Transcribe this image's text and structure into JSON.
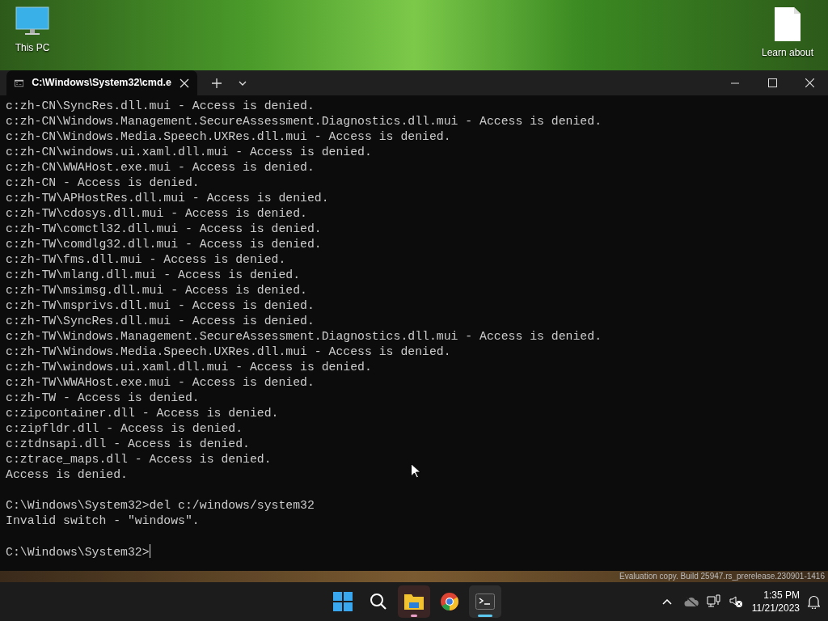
{
  "desktop_icons": [
    {
      "kind": "pc",
      "label": "This PC"
    },
    {
      "kind": "file",
      "label": "Learn about"
    }
  ],
  "terminal": {
    "tab_title": "C:\\Windows\\System32\\cmd.e",
    "blocks": [
      [
        "c:zh-CN\\SyncRes.dll.mui - Access is denied.",
        "c:zh-CN\\Windows.Management.SecureAssessment.Diagnostics.dll.mui - Access is denied.",
        "c:zh-CN\\Windows.Media.Speech.UXRes.dll.mui - Access is denied.",
        "c:zh-CN\\windows.ui.xaml.dll.mui - Access is denied.",
        "c:zh-CN\\WWAHost.exe.mui - Access is denied.",
        "c:zh-CN - Access is denied.",
        "c:zh-TW\\APHostRes.dll.mui - Access is denied.",
        "c:zh-TW\\cdosys.dll.mui - Access is denied.",
        "c:zh-TW\\comctl32.dll.mui - Access is denied.",
        "c:zh-TW\\comdlg32.dll.mui - Access is denied.",
        "c:zh-TW\\fms.dll.mui - Access is denied.",
        "c:zh-TW\\mlang.dll.mui - Access is denied.",
        "c:zh-TW\\msimsg.dll.mui - Access is denied.",
        "c:zh-TW\\msprivs.dll.mui - Access is denied.",
        "c:zh-TW\\SyncRes.dll.mui - Access is denied.",
        "c:zh-TW\\Windows.Management.SecureAssessment.Diagnostics.dll.mui - Access is denied.",
        "c:zh-TW\\Windows.Media.Speech.UXRes.dll.mui - Access is denied.",
        "c:zh-TW\\windows.ui.xaml.dll.mui - Access is denied.",
        "c:zh-TW\\WWAHost.exe.mui - Access is denied.",
        "c:zh-TW - Access is denied.",
        "c:zipcontainer.dll - Access is denied.",
        "c:zipfldr.dll - Access is denied.",
        "c:ztdnsapi.dll - Access is denied.",
        "c:ztrace_maps.dll - Access is denied.",
        "Access is denied."
      ],
      [
        "C:\\Windows\\System32>del c:/windows/system32",
        "Invalid switch - \"windows\"."
      ]
    ],
    "prompt": "C:\\Windows\\System32>"
  },
  "watermark": "Evaluation copy. Build 25947.rs_prerelease.230901-1416",
  "taskbar": {
    "apps": [
      {
        "kind": "start",
        "running": false,
        "selected": false
      },
      {
        "kind": "search",
        "running": false,
        "selected": false
      },
      {
        "kind": "explorer",
        "running": true,
        "selected": false
      },
      {
        "kind": "chrome",
        "running": false,
        "selected": false
      },
      {
        "kind": "terminal",
        "running": true,
        "selected": true
      }
    ],
    "time": "1:35 PM",
    "date": "11/21/2023"
  }
}
